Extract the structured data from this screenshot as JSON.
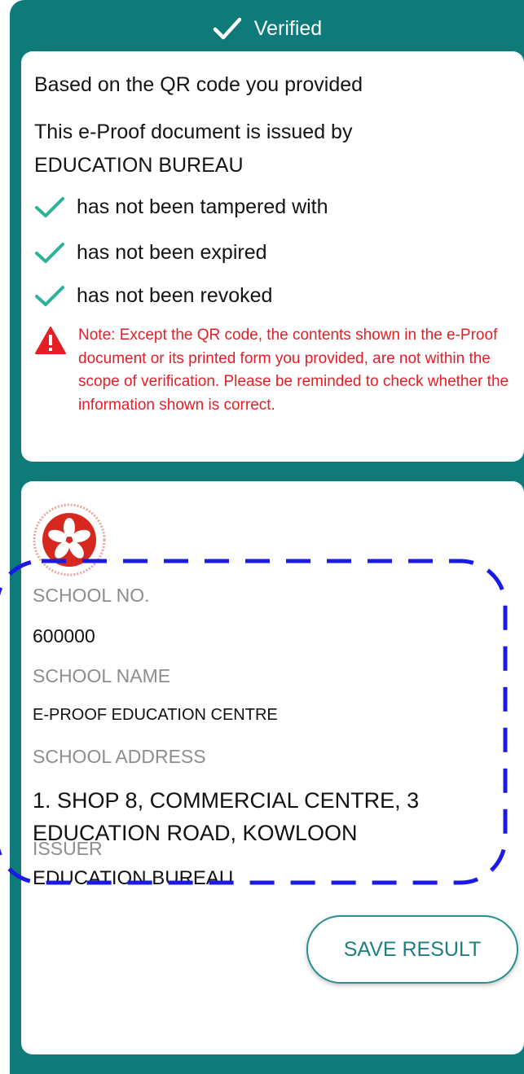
{
  "banner": {
    "status": "Verified",
    "icon": "check-icon"
  },
  "verification": {
    "intro": "Based on the QR code you provided",
    "issued_by_line": "This e-Proof document is issued by",
    "issuer_name": "EDUCATION BUREAU",
    "checks": [
      "has not been tampered with",
      "has not been expired",
      "has not been revoked"
    ],
    "note": "Note: Except the QR code, the contents shown in the e-Proof document or its printed form you provided, are not within the scope of verification. Please be reminded to check whether the information shown is correct.",
    "note_icon": "warning-triangle-icon"
  },
  "details": {
    "emblem_icon": "hksar-emblem-icon",
    "fields": [
      {
        "label": "SCHOOL NO.",
        "value": "600000"
      },
      {
        "label": "SCHOOL NAME",
        "value": "E-PROOF EDUCATION CENTRE"
      },
      {
        "label": "SCHOOL ADDRESS",
        "value": "1. SHOP 8, COMMERCIAL CENTRE, 3 EDUCATION ROAD, KOWLOON"
      },
      {
        "label": "ISSUER",
        "value": "EDUCATION BUREAU"
      }
    ]
  },
  "actions": {
    "save_label": "SAVE RESULT"
  },
  "colors": {
    "teal": "#0e7a7a",
    "check_green": "#2bb39a",
    "warning_red": "#e41e26",
    "highlight_blue": "#1a1ae6"
  }
}
